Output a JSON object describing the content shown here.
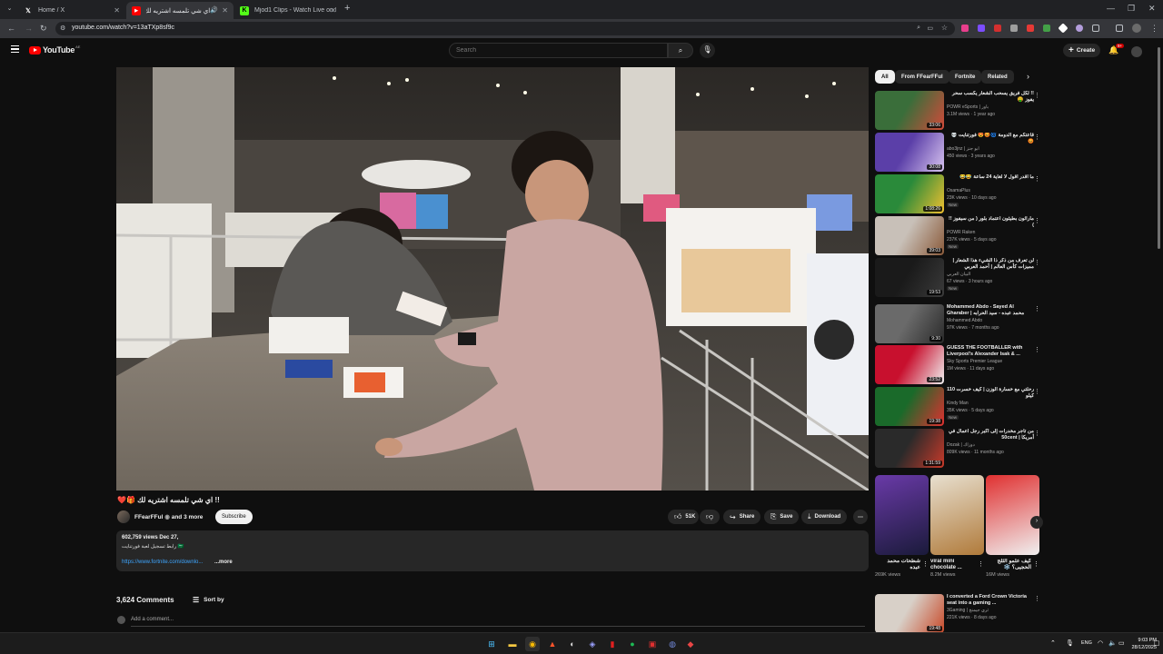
{
  "browser": {
    "tabs": [
      {
        "label": "Home / X",
        "favicon": "x-logo-icon",
        "active": false
      },
      {
        "label": "!! اي شي تلمسه اشتريه لك (953)",
        "favicon": "youtube-icon",
        "active": true
      },
      {
        "label": "Mjod1 Clips - Watch Live on Ki",
        "favicon": "kick-icon",
        "active": false
      }
    ],
    "url": "youtube.com/watch?v=13aTXp8sf9c"
  },
  "header": {
    "brand": "YouTube",
    "region": "AE",
    "search_placeholder": "Search",
    "create_label": "Create",
    "notification_badge": "9+"
  },
  "video": {
    "title": "!! اي شي تلمسه اشتريه لك 🎁❤️",
    "channel": "FFearFFul",
    "channel_suffix": "and 3 more",
    "subscribe_label": "Subscribe",
    "likes": "51K",
    "share_label": "Share",
    "save_label": "Save",
    "download_label": "Download",
    "views": "602,759 views",
    "date": "Dec 27,",
    "desc_line": "رابط تسجيل لعبة فورتنايت 🇸🇦",
    "desc_link": "https://www.fortnite.com/downlo...",
    "more_label": "...more"
  },
  "comments": {
    "count": "3,624 Comments",
    "sort_label": "Sort by",
    "add_placeholder": "Add a comment..."
  },
  "sidebar": {
    "chips": [
      "All",
      "From FFearFFul",
      "Fortnite",
      "Related"
    ],
    "recommendations": [
      {
        "title": "!! لكل فريق يسحب الشعار يكسب سحر يفوز 🤑",
        "channel": "POWR eSports | باور",
        "meta": "3.1M views · 1 year ago",
        "duration": "33:06",
        "badge": "",
        "color1": "#3a6e3a",
        "color2": "#d24a3a"
      },
      {
        "title": "قاعتكم مع الدومة 🌀😡😍 فورتنايت 💀😡",
        "channel": "abo3jnz | ابو جنز",
        "meta": "450 views · 3 years ago",
        "duration": "30:08",
        "badge": "",
        "color1": "#5b3fa8",
        "color2": "#d8c4f0"
      },
      {
        "title": "ما اقدر اقول لا لغاية 24 ساعة 😂😂",
        "channel": "OsamaPlus",
        "meta": "23K views · 10 days ago",
        "duration": "1:08:26",
        "badge": "New",
        "color1": "#2a8a3a",
        "color2": "#f0c030"
      },
      {
        "title": "ماراثون بطيئون اعتماد بلور ( من سيفوز !! )",
        "channel": "POWR Raken",
        "meta": "237K views · 5 days ago",
        "duration": "39:03",
        "badge": "New",
        "color1": "#c8c0b8",
        "color2": "#8a5a3a"
      },
      {
        "title": "لن تعرف من ذكر ذا الشيء هذا الشعار | مميزات كأس العالم | أحمد العربي",
        "channel": "البيان العربي",
        "meta": "67 views · 3 hours ago",
        "duration": "19:53",
        "badge": "New",
        "color1": "#1a1a1a",
        "color2": "#3a3a3a"
      },
      {
        "title": "Mohammed Abdo - Sayed Al Gharaber | محمد عبده - سيد الحرابه",
        "channel": "Mohammed Abdo",
        "meta": "97K views · 7 months ago",
        "duration": "9:30",
        "badge": "",
        "color1": "#6a6a6a",
        "color2": "#2a2a2a"
      },
      {
        "title": "GUESS THE FOOTBALLER with Liverpool's Alexander Isak & ...",
        "channel": "Sky Sports Premier League",
        "meta": "1M views · 11 days ago",
        "duration": "23:52",
        "badge": "",
        "color1": "#c8102e",
        "color2": "#f0f0f0"
      },
      {
        "title": "رحلتي مع خسارة الوزن | كيف خسرت 110 كيلو",
        "channel": "Kindy Man",
        "meta": "35K views · 5 days ago",
        "duration": "19:38",
        "badge": "New",
        "color1": "#1a6a2a",
        "color2": "#e03030"
      },
      {
        "title": "من تاجر مخدرات إلى أكبر رجل أعمال في أمريكا | 50cent",
        "channel": "Dozak | دوزاك",
        "meta": "809K views · 11 months ago",
        "duration": "1:31:59",
        "badge": "",
        "color1": "#2a2a2a",
        "color2": "#c83a2a"
      },
      {
        "title": "I converted a Ford Crown Victoria seat into a gaming ...",
        "channel": "3Gaming | ثري جيمنج",
        "meta": "221K views · 8 days ago",
        "duration": "19:48",
        "badge": "",
        "color1": "#d8d0c8",
        "color2": "#c84a2a"
      }
    ],
    "shorts": [
      {
        "title": "شطحات محمد عبده",
        "views": "269K views",
        "color1": "#6a3aa8",
        "color2": "#1a1a3a"
      },
      {
        "title": "viral mini chocolate ...",
        "views": "8.2M views",
        "color1": "#e8e0d0",
        "color2": "#b07a3a"
      },
      {
        "title": "كيف علمو الثلج الحجيى؟ ❄️",
        "views": "16M views",
        "color1": "#e03030",
        "color2": "#f0f0f0"
      }
    ]
  },
  "taskbar": {
    "lang": "ENG",
    "time": "9:03 PM",
    "date": "28/12/2025"
  }
}
